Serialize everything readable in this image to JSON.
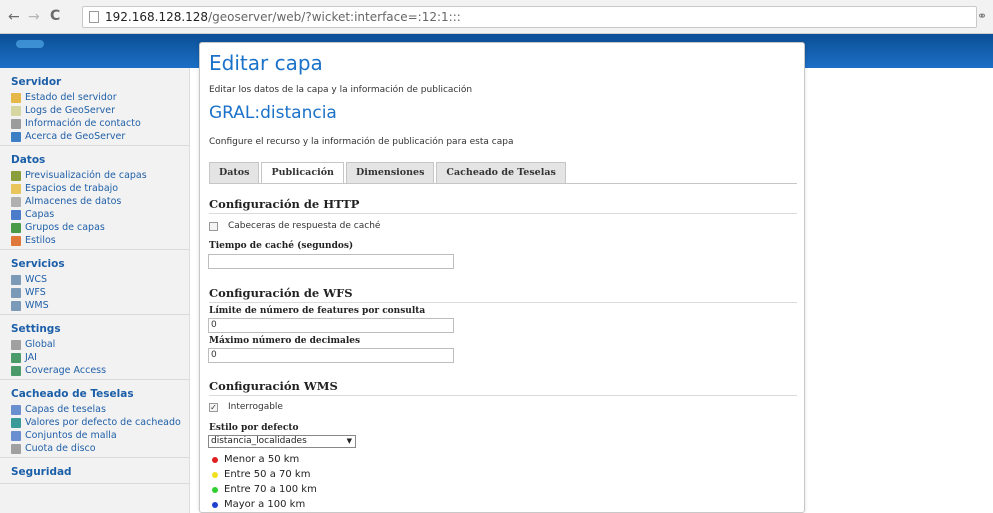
{
  "browser": {
    "back_icon": "back-arrow-icon",
    "forward_icon": "forward-arrow-icon",
    "reload_icon": "reload-icon",
    "url_host": "192.168.128.128",
    "url_path": "/geoserver/web/?wicket:interface=:12:1:::"
  },
  "sidebar": {
    "sections": [
      {
        "title": "Servidor",
        "items": [
          {
            "label": "Estado del servidor",
            "icon": "server-status-icon",
            "color": "#e6b84a"
          },
          {
            "label": "Logs de GeoServer",
            "icon": "logs-icon",
            "color": "#d6d6a0"
          },
          {
            "label": "Información de contacto",
            "icon": "contact-icon",
            "color": "#9c9c9c"
          },
          {
            "label": "Acerca de GeoServer",
            "icon": "about-icon",
            "color": "#3c7fc4"
          }
        ]
      },
      {
        "title": "Datos",
        "items": [
          {
            "label": "Previsualización de capas",
            "icon": "layer-preview-icon",
            "color": "#8a9f3a"
          },
          {
            "label": "Espacios de trabajo",
            "icon": "workspace-icon",
            "color": "#e8c45a"
          },
          {
            "label": "Almacenes de datos",
            "icon": "datastore-icon",
            "color": "#b0b0b0"
          },
          {
            "label": "Capas",
            "icon": "layers-icon",
            "color": "#4a7cc9"
          },
          {
            "label": "Grupos de capas",
            "icon": "layer-groups-icon",
            "color": "#4a9a4a"
          },
          {
            "label": "Estilos",
            "icon": "styles-icon",
            "color": "#e0783a"
          }
        ]
      },
      {
        "title": "Servicios",
        "items": [
          {
            "label": "WCS",
            "icon": "wcs-icon",
            "color": "#7a9ab8"
          },
          {
            "label": "WFS",
            "icon": "wfs-icon",
            "color": "#7a9ab8"
          },
          {
            "label": "WMS",
            "icon": "wms-icon",
            "color": "#7a9ab8"
          }
        ]
      },
      {
        "title": "Settings",
        "items": [
          {
            "label": "Global",
            "icon": "global-icon",
            "color": "#a0a0a0"
          },
          {
            "label": "JAI",
            "icon": "jai-icon",
            "color": "#4a9a6a"
          },
          {
            "label": "Coverage Access",
            "icon": "coverage-access-icon",
            "color": "#4a9a6a"
          }
        ]
      },
      {
        "title": "Cacheado de Teselas",
        "items": [
          {
            "label": "Capas de teselas",
            "icon": "tile-layers-icon",
            "color": "#6a8fd0"
          },
          {
            "label": "Valores por defecto de cacheado",
            "icon": "caching-defaults-icon",
            "color": "#3a9a9a"
          },
          {
            "label": "Conjuntos de malla",
            "icon": "gridsets-icon",
            "color": "#6a8fd0"
          },
          {
            "label": "Cuota de disco",
            "icon": "disk-quota-icon",
            "color": "#a0a0a0"
          }
        ]
      },
      {
        "title": "Seguridad",
        "items": []
      }
    ]
  },
  "main": {
    "title": "Editar capa",
    "description": "Editar los datos de la capa y la información de publicación",
    "layer_name": "GRAL:distancia",
    "layer_description": "Configure el recurso y la información de publicación para esta capa",
    "tabs": [
      "Datos",
      "Publicación",
      "Dimensiones",
      "Cacheado de Teselas"
    ],
    "active_tab": "Publicación",
    "http": {
      "heading": "Configuración de HTTP",
      "cache_headers_label": "Cabeceras de respuesta de caché",
      "cache_time_label": "Tiempo de caché (segundos)",
      "cache_time_value": ""
    },
    "wfs": {
      "heading": "Configuración de WFS",
      "max_features_label": "Límite de número de features por consulta",
      "max_features_value": "0",
      "max_decimals_label": "Máximo número de decimales",
      "max_decimals_value": "0"
    },
    "wms": {
      "heading": "Configuración WMS",
      "queryable_label": "Interrogable",
      "queryable_checked": true,
      "default_style_label": "Estilo por defecto",
      "default_style_value": "distancia_localidades",
      "legend": [
        {
          "label": "Menor a 50 km",
          "color": "#e02020"
        },
        {
          "label": "Entre 50 a 70 km",
          "color": "#f0e020"
        },
        {
          "label": "Entre 70 a 100 km",
          "color": "#30d030"
        },
        {
          "label": "Mayor a 100 km",
          "color": "#2040d0"
        }
      ]
    }
  }
}
